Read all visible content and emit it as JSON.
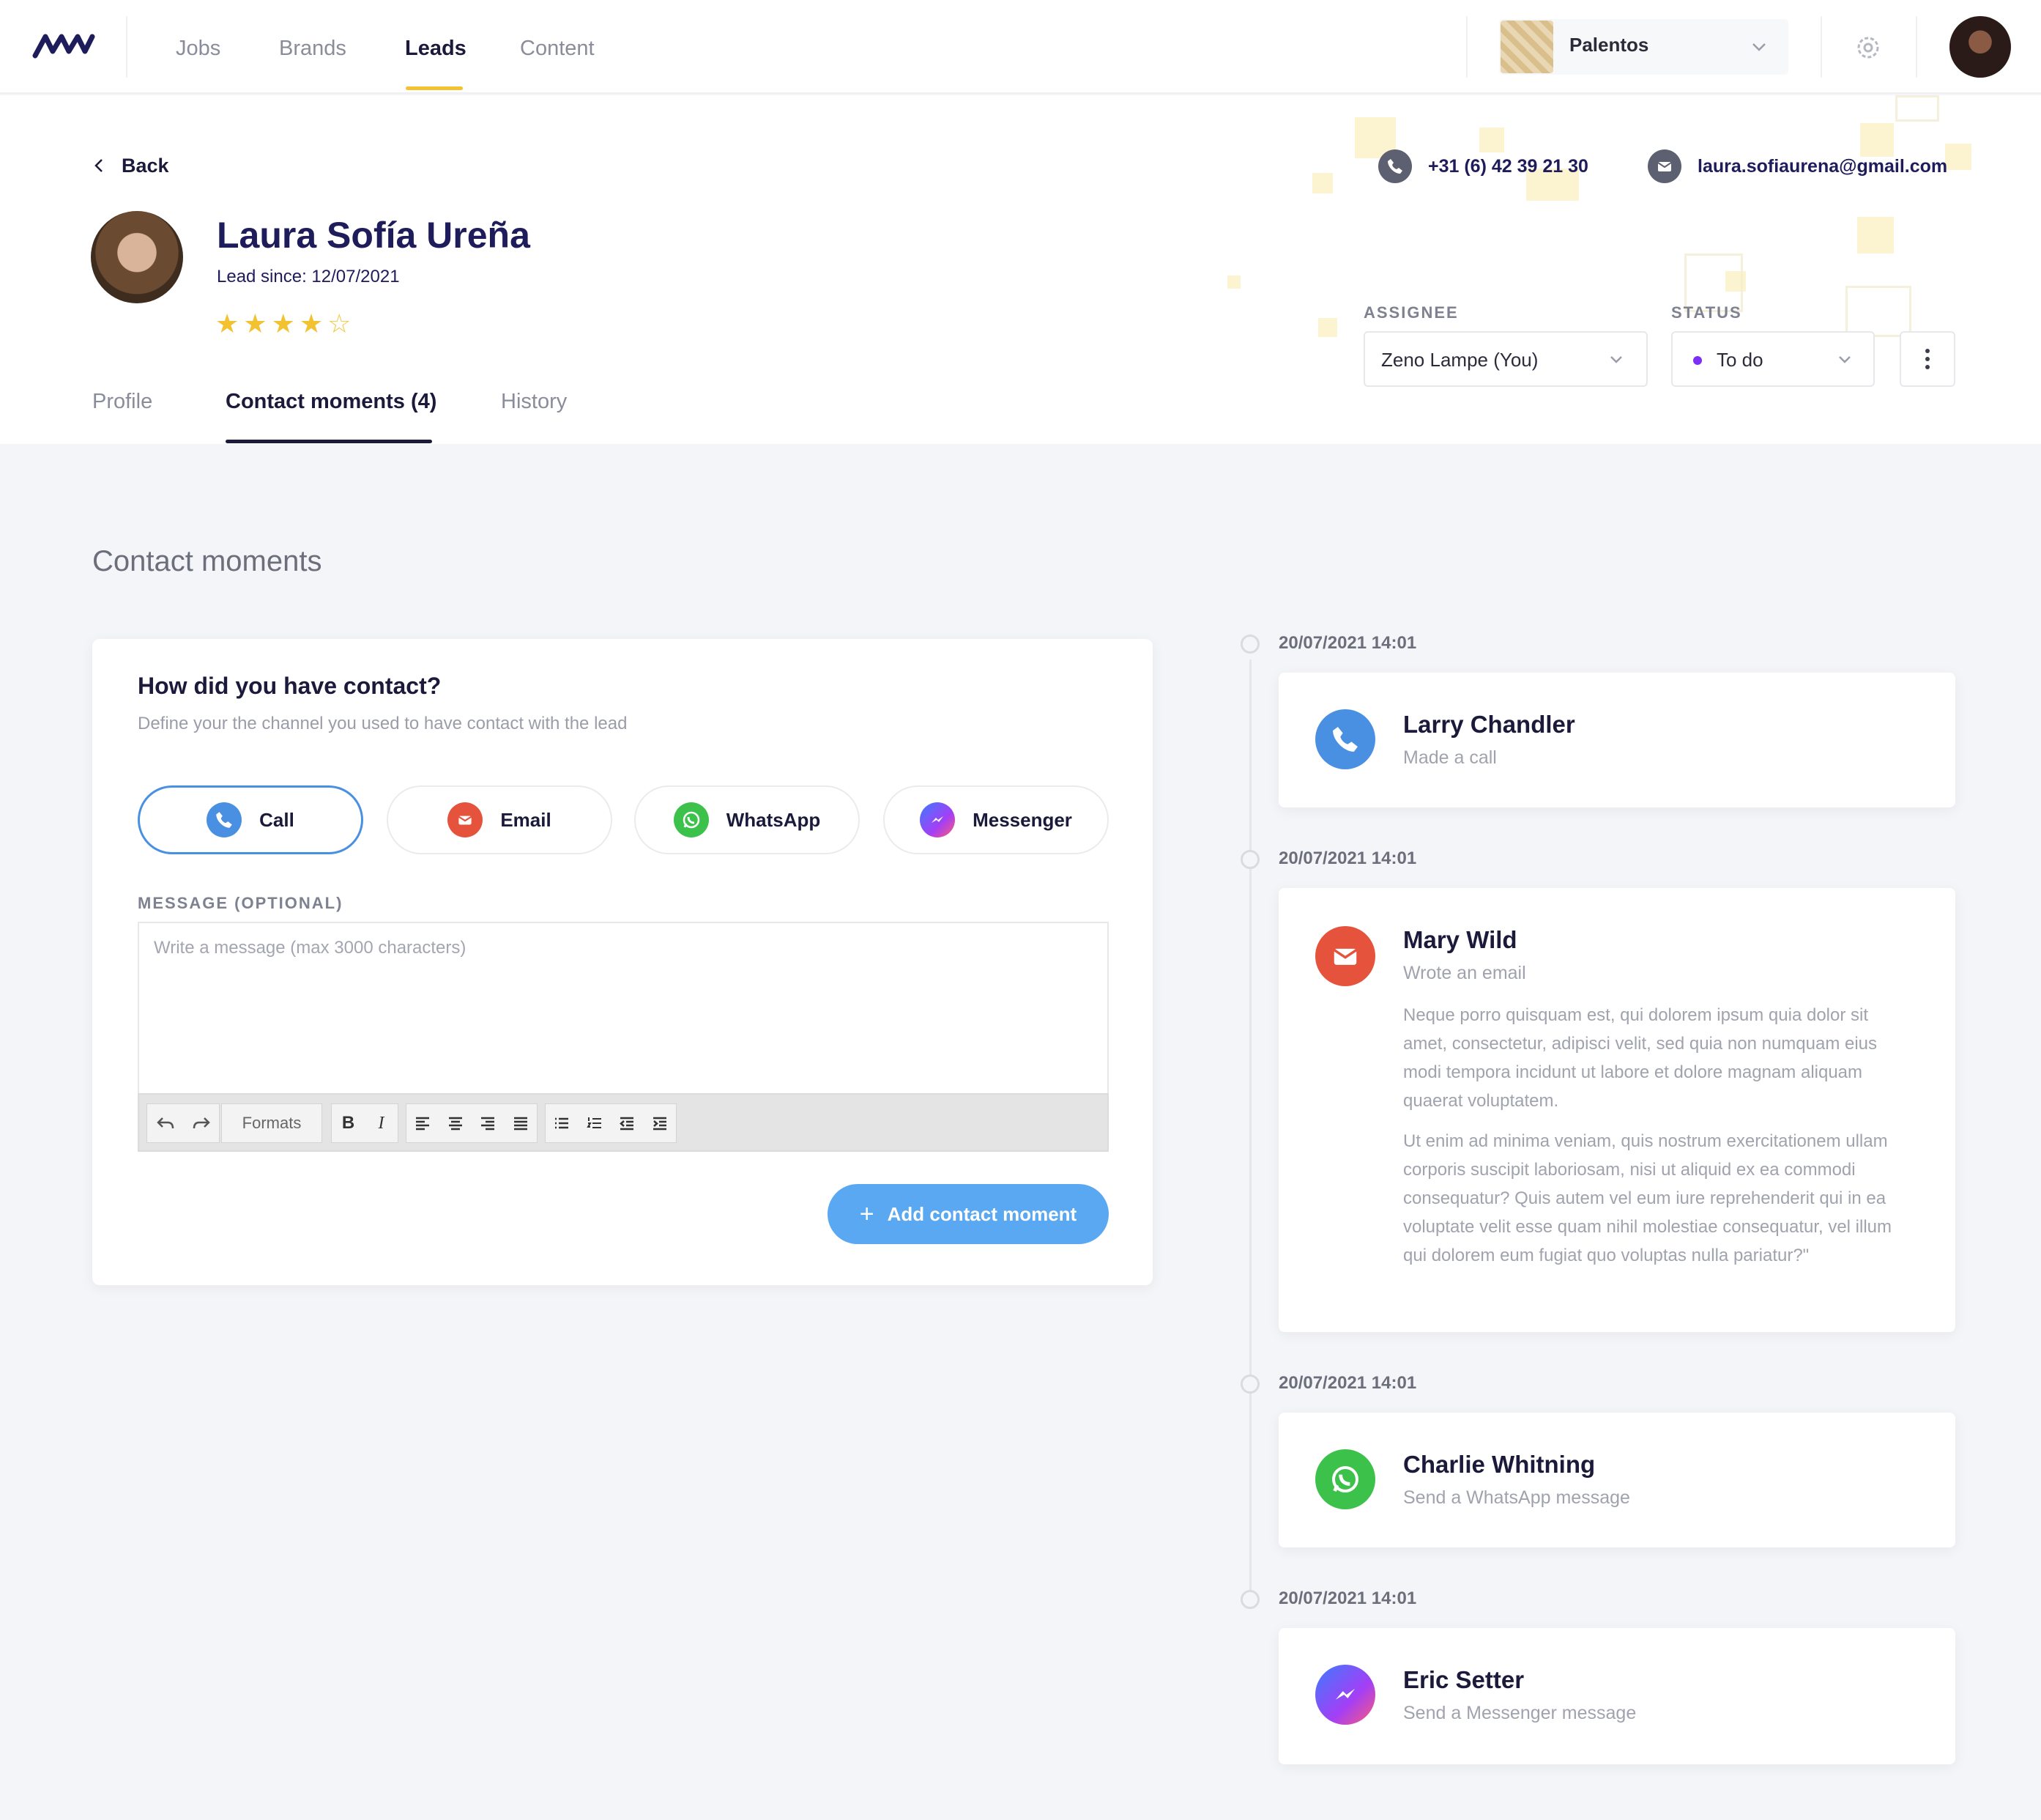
{
  "nav": {
    "tabs": [
      {
        "label": "Jobs"
      },
      {
        "label": "Brands"
      },
      {
        "label": "Leads",
        "active": true
      },
      {
        "label": "Content"
      }
    ],
    "brand_selector": {
      "value": "Palentos"
    },
    "icons": {
      "logo": "mw-logo",
      "settings": "gear-icon",
      "avatar": "user-avatar"
    }
  },
  "lead": {
    "back_label": "Back",
    "name": "Laura Sofía Ureña",
    "since": "Lead since: 12/07/2021",
    "rating": 4,
    "rating_max": 5,
    "phone": "+31 (6) 42 39 21 30",
    "email": "laura.sofiaurena@gmail.com",
    "assignee_label": "ASSIGNEE",
    "assignee_value": "Zeno Lampe (You)",
    "status_label": "STATUS",
    "status_value": "To do"
  },
  "subtabs": [
    {
      "label": "Profile"
    },
    {
      "label": "Contact moments (4)",
      "active": true
    },
    {
      "label": "History"
    }
  ],
  "contact_moments": {
    "section_title": "Contact moments",
    "form": {
      "title": "How did you have contact?",
      "subtitle": "Define your the channel you used to have contact with the lead",
      "channels": [
        {
          "label": "Call",
          "icon": "phone-icon",
          "selected": true
        },
        {
          "label": "Email",
          "icon": "mail-icon"
        },
        {
          "label": "WhatsApp",
          "icon": "whatsapp-icon"
        },
        {
          "label": "Messenger",
          "icon": "messenger-icon"
        }
      ],
      "message_label": "MESSAGE (OPTIONAL)",
      "message_placeholder": "Write a message (max 3000 characters)",
      "toolbar_formats": "Formats",
      "toolbar_bold": "B",
      "toolbar_italic": "I",
      "submit_label": "Add contact moment"
    },
    "timeline": [
      {
        "date": "20/07/2021  14:01",
        "name": "Larry Chandler",
        "action": "Made a call",
        "icon": "phone-icon"
      },
      {
        "date": "20/07/2021  14:01",
        "name": "Mary Wild",
        "action": "Wrote an email",
        "icon": "mail-icon",
        "paragraphs": [
          "Neque porro quisquam est, qui dolorem ipsum quia dolor sit amet, consectetur, adipisci velit, sed quia non numquam eius modi tempora incidunt ut labore et dolore magnam aliquam quaerat voluptatem.",
          "Ut enim ad minima veniam, quis nostrum exercitationem ullam corporis suscipit laboriosam, nisi ut aliquid ex ea commodi consequatur? Quis autem vel eum iure reprehenderit qui in ea voluptate velit esse quam nihil molestiae consequatur, vel illum qui dolorem eum fugiat quo voluptas nulla pariatur?\""
        ]
      },
      {
        "date": "20/07/2021  14:01",
        "name": "Charlie Whitning",
        "action": "Send a WhatsApp message",
        "icon": "whatsapp-icon"
      },
      {
        "date": "20/07/2021  14:01",
        "name": "Eric Setter",
        "action": "Send a Messenger message",
        "icon": "messenger-icon"
      }
    ]
  },
  "colors": {
    "accent_yellow": "#f2c230",
    "navy": "#1f1c5c",
    "call_blue": "#4a90e2",
    "email_red": "#e5533d",
    "whatsapp_green": "#3cc14b",
    "messenger_purple": "#8a3ffc",
    "button_blue": "#5aa7f2",
    "status_purple": "#7b2ff7"
  }
}
